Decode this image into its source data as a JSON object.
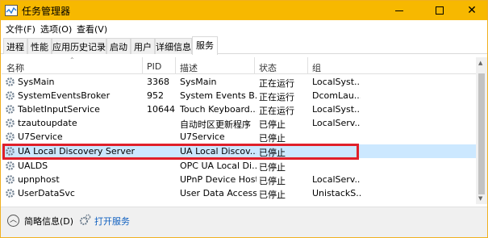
{
  "window": {
    "title": "任务管理器",
    "accent": "#f7b800"
  },
  "menu": {
    "items": [
      "文件(F)",
      "选项(O)",
      "查看(V)"
    ]
  },
  "tabs": [
    {
      "label": "进程"
    },
    {
      "label": "性能"
    },
    {
      "label": "应用历史记录"
    },
    {
      "label": "启动"
    },
    {
      "label": "用户"
    },
    {
      "label": "详细信息"
    },
    {
      "label": "服务",
      "active": true
    }
  ],
  "columns": {
    "name": "名称",
    "pid": "PID",
    "desc": "描述",
    "status": "状态",
    "group": "组"
  },
  "rows": [
    {
      "name": "SysMain",
      "pid": "3368",
      "desc": "SysMain",
      "status": "正在运行",
      "group": "LocalSyst..."
    },
    {
      "name": "SystemEventsBroker",
      "pid": "952",
      "desc": "System Events B...",
      "status": "正在运行",
      "group": "DcomLau..."
    },
    {
      "name": "TabletInputService",
      "pid": "10644",
      "desc": "Touch Keyboard...",
      "status": "正在运行",
      "group": "LocalSyst..."
    },
    {
      "name": "tzautoupdate",
      "pid": "",
      "desc": "自动时区更新程序",
      "status": "已停止",
      "group": "LocalServ..."
    },
    {
      "name": "U7Service",
      "pid": "",
      "desc": "U7Service",
      "status": "已停止",
      "group": ""
    },
    {
      "name": "UA Local Discovery Server",
      "pid": "",
      "desc": "UA Local Discov...",
      "status": "已停止",
      "group": "",
      "selected": true
    },
    {
      "name": "UALDS",
      "pid": "",
      "desc": "OPC UA Local Di...",
      "status": "已停止",
      "group": ""
    },
    {
      "name": "upnphost",
      "pid": "",
      "desc": "UPnP Device Host",
      "status": "已停止",
      "group": "LocalServ..."
    },
    {
      "name": "UserDataSvc",
      "pid": "",
      "desc": "User Data Access",
      "status": "已停止",
      "group": "UnistackS..."
    }
  ],
  "footer": {
    "brief_label": "简略信息(D)",
    "open_services_label": "打开服务"
  },
  "colors": {
    "selected_row": "#cce8ff",
    "highlight_border": "#e0202a",
    "link": "#1060c0"
  }
}
